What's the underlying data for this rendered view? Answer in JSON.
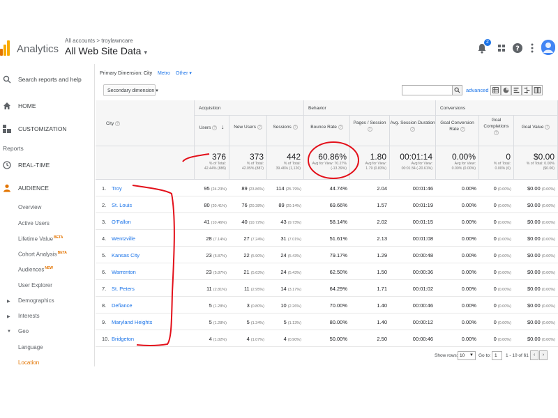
{
  "header": {
    "brand": "Analytics",
    "breadcrumb": "All accounts > troylawncare",
    "view": "All Web Site Data",
    "caret": "▾",
    "notif_count": "2"
  },
  "sidebar": {
    "search_label": "Search reports and help",
    "home": "HOME",
    "customization": "CUSTOMIZATION",
    "reports": "Reports",
    "realtime": "REAL-TIME",
    "audience": "AUDIENCE",
    "sub_items": [
      {
        "label": "Overview"
      },
      {
        "label": "Active Users"
      },
      {
        "label": "Lifetime Value",
        "badge": "BETA"
      },
      {
        "label": "Cohort Analysis",
        "badge": "BETA"
      },
      {
        "label": "Audiences",
        "badge": "NEW"
      },
      {
        "label": "User Explorer"
      }
    ],
    "expand_items": [
      {
        "label": "Demographics",
        "arrow": "▶"
      },
      {
        "label": "Interests",
        "arrow": "▶"
      },
      {
        "label": "Geo",
        "arrow": "▼"
      }
    ],
    "geo_items": [
      {
        "label": "Language"
      },
      {
        "label": "Location"
      }
    ]
  },
  "toolbar": {
    "primary_dimension_label": "Primary Dimension:",
    "primary_dimension_value": "City",
    "metro": "Metro",
    "other": "Other ▾",
    "secondary_dimension": "Secondary dimension ▾",
    "advanced": "advanced"
  },
  "table": {
    "group_acquisition": "Acquisition",
    "group_behavior": "Behavior",
    "group_conversions": "Conversions",
    "col_city": "City",
    "col_users": "Users",
    "col_new_users": "New Users",
    "col_sessions": "Sessions",
    "col_bounce_rate": "Bounce Rate",
    "col_pages_session": "Pages / Session",
    "col_avg_session": "Avg. Session Duration",
    "col_goal_conv": "Goal Conversion Rate",
    "col_goal_comp": "Goal Completions",
    "col_goal_value": "Goal Value",
    "totals": {
      "users": {
        "v": "376",
        "s1": "% of Total:",
        "s2": "42.44% (886)"
      },
      "new_users": {
        "v": "373",
        "s1": "% of Total:",
        "s2": "42.05% (887)"
      },
      "sessions": {
        "v": "442",
        "s1": "% of Total:",
        "s2": "39.46% (1,120)"
      },
      "bounce": {
        "v": "60.86%",
        "s1": "Avg for View: 70.27%",
        "s2": "(-13.39%)"
      },
      "pages": {
        "v": "1.80",
        "s1": "Avg for View:",
        "s2": "1.79 (0.83%)"
      },
      "duration": {
        "v": "00:01:14",
        "s1": "Avg for View:",
        "s2": "00:01:34 (-20.61%)"
      },
      "goal_conv": {
        "v": "0.00%",
        "s1": "Avg for View:",
        "s2": "0.00% (0.00%)"
      },
      "goal_comp": {
        "v": "0",
        "s1": "% of Total:",
        "s2": "0.00% (0)"
      },
      "goal_value": {
        "v": "$0.00",
        "s1": "% of Total: 0.00%",
        "s2": "($0.00)"
      }
    },
    "rows": [
      {
        "idx": "1.",
        "city": "Troy",
        "users": "95",
        "users_p": "(24.23%)",
        "new": "89",
        "new_p": "(23.86%)",
        "sess": "114",
        "sess_p": "(25.79%)",
        "bounce": "44.74%",
        "pages": "2.04",
        "dur": "00:01:46",
        "gcr": "0.00%",
        "gc": "0",
        "gc_p": "(0.00%)",
        "gv": "$0.00",
        "gv_p": "(0.00%)"
      },
      {
        "idx": "2.",
        "city": "St. Louis",
        "users": "80",
        "users_p": "(20.41%)",
        "new": "76",
        "new_p": "(20.38%)",
        "sess": "89",
        "sess_p": "(20.14%)",
        "bounce": "69.66%",
        "pages": "1.57",
        "dur": "00:01:19",
        "gcr": "0.00%",
        "gc": "0",
        "gc_p": "(0.00%)",
        "gv": "$0.00",
        "gv_p": "(0.00%)"
      },
      {
        "idx": "3.",
        "city": "O'Fallon",
        "users": "41",
        "users_p": "(10.46%)",
        "new": "40",
        "new_p": "(10.72%)",
        "sess": "43",
        "sess_p": "(9.73%)",
        "bounce": "58.14%",
        "pages": "2.02",
        "dur": "00:01:15",
        "gcr": "0.00%",
        "gc": "0",
        "gc_p": "(0.00%)",
        "gv": "$0.00",
        "gv_p": "(0.00%)"
      },
      {
        "idx": "4.",
        "city": "Wentzville",
        "users": "28",
        "users_p": "(7.14%)",
        "new": "27",
        "new_p": "(7.24%)",
        "sess": "31",
        "sess_p": "(7.01%)",
        "bounce": "51.61%",
        "pages": "2.13",
        "dur": "00:01:08",
        "gcr": "0.00%",
        "gc": "0",
        "gc_p": "(0.00%)",
        "gv": "$0.00",
        "gv_p": "(0.00%)"
      },
      {
        "idx": "5.",
        "city": "Kansas City",
        "users": "23",
        "users_p": "(5.87%)",
        "new": "22",
        "new_p": "(5.90%)",
        "sess": "24",
        "sess_p": "(5.43%)",
        "bounce": "79.17%",
        "pages": "1.29",
        "dur": "00:00:48",
        "gcr": "0.00%",
        "gc": "0",
        "gc_p": "(0.00%)",
        "gv": "$0.00",
        "gv_p": "(0.00%)"
      },
      {
        "idx": "6.",
        "city": "Warrenton",
        "users": "23",
        "users_p": "(5.87%)",
        "new": "21",
        "new_p": "(5.63%)",
        "sess": "24",
        "sess_p": "(5.43%)",
        "bounce": "62.50%",
        "pages": "1.50",
        "dur": "00:00:36",
        "gcr": "0.00%",
        "gc": "0",
        "gc_p": "(0.00%)",
        "gv": "$0.00",
        "gv_p": "(0.00%)"
      },
      {
        "idx": "7.",
        "city": "St. Peters",
        "users": "11",
        "users_p": "(2.81%)",
        "new": "11",
        "new_p": "(2.95%)",
        "sess": "14",
        "sess_p": "(3.17%)",
        "bounce": "64.29%",
        "pages": "1.71",
        "dur": "00:01:02",
        "gcr": "0.00%",
        "gc": "0",
        "gc_p": "(0.00%)",
        "gv": "$0.00",
        "gv_p": "(0.00%)"
      },
      {
        "idx": "8.",
        "city": "Defiance",
        "users": "5",
        "users_p": "(1.28%)",
        "new": "3",
        "new_p": "(0.80%)",
        "sess": "10",
        "sess_p": "(2.26%)",
        "bounce": "70.00%",
        "pages": "1.40",
        "dur": "00:00:46",
        "gcr": "0.00%",
        "gc": "0",
        "gc_p": "(0.00%)",
        "gv": "$0.00",
        "gv_p": "(0.00%)"
      },
      {
        "idx": "9.",
        "city": "Maryland Heights",
        "users": "5",
        "users_p": "(1.28%)",
        "new": "5",
        "new_p": "(1.34%)",
        "sess": "5",
        "sess_p": "(1.13%)",
        "bounce": "80.00%",
        "pages": "1.40",
        "dur": "00:00:12",
        "gcr": "0.00%",
        "gc": "0",
        "gc_p": "(0.00%)",
        "gv": "$0.00",
        "gv_p": "(0.00%)"
      },
      {
        "idx": "10.",
        "city": "Bridgeton",
        "users": "4",
        "users_p": "(1.02%)",
        "new": "4",
        "new_p": "(1.07%)",
        "sess": "4",
        "sess_p": "(0.90%)",
        "bounce": "50.00%",
        "pages": "2.50",
        "dur": "00:00:46",
        "gcr": "0.00%",
        "gc": "0",
        "gc_p": "(0.00%)",
        "gv": "$0.00",
        "gv_p": "(0.00%)"
      }
    ]
  },
  "footer": {
    "show_rows": "Show rows:",
    "rows_value": "10",
    "goto": "Go to:",
    "goto_value": "1",
    "range": "1 - 10 of 61",
    "prev": "‹",
    "next": "›"
  },
  "colors": {
    "accent": "#e37400",
    "link": "#1a73e8",
    "annotation": "#e3101a"
  }
}
